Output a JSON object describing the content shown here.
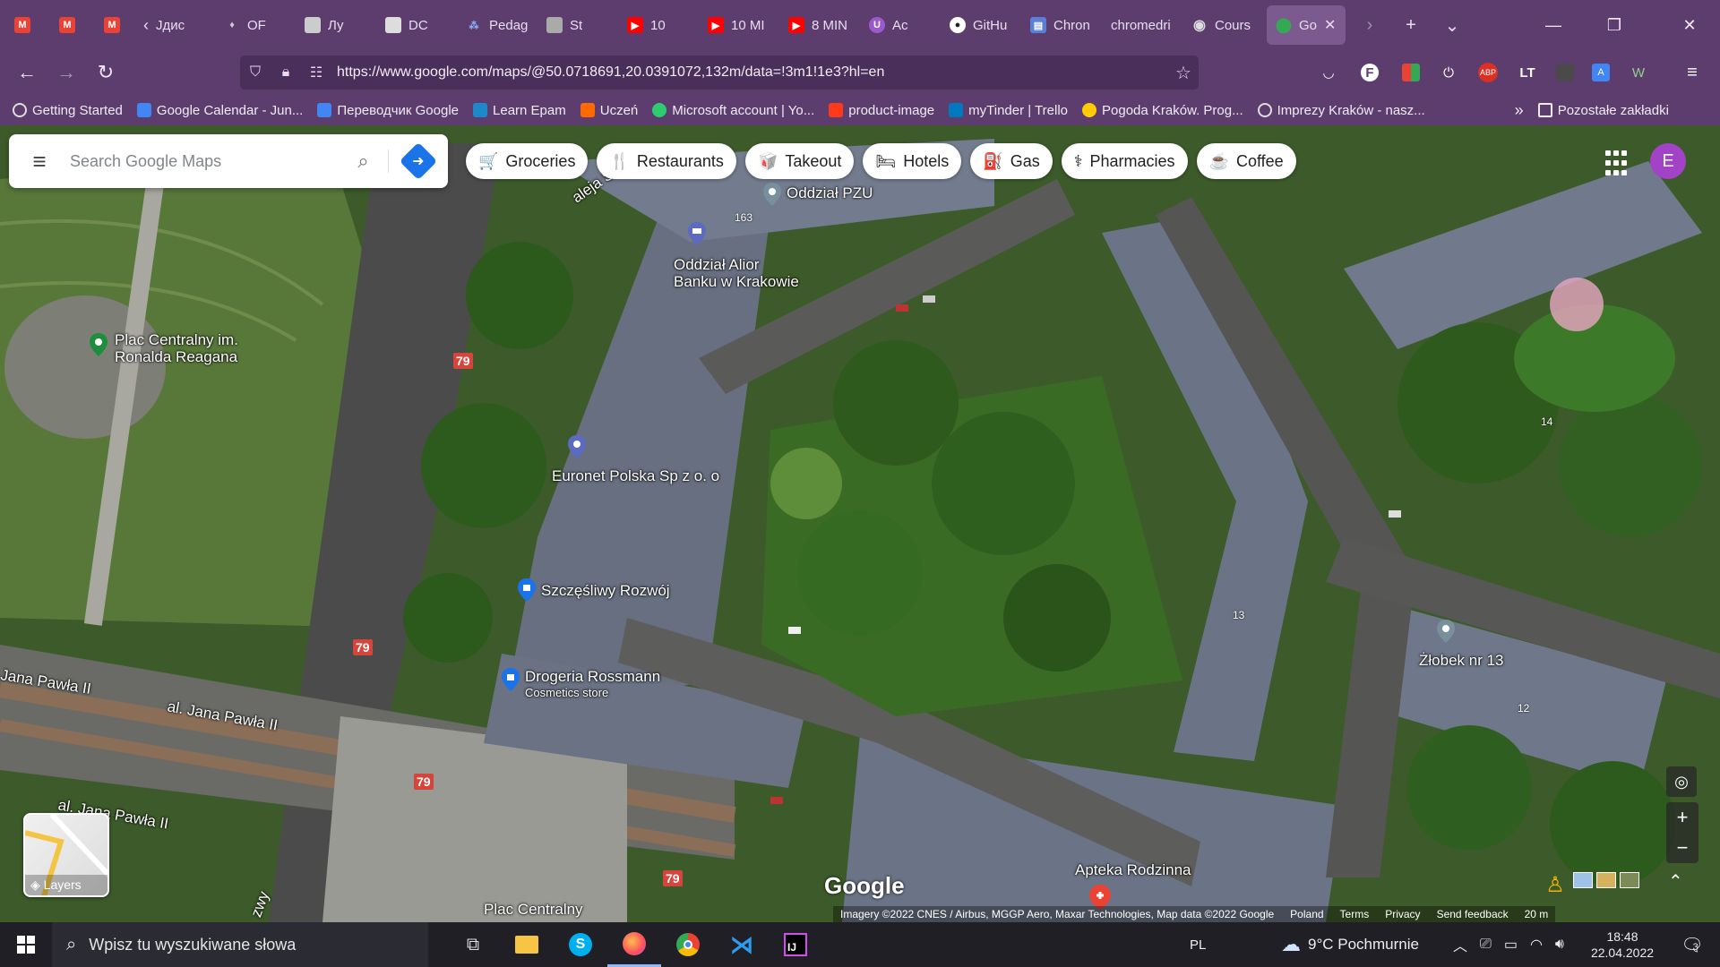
{
  "tabs": [
    {
      "label": "",
      "icon": "gmail-icon",
      "color": "#ea4335"
    },
    {
      "label": "",
      "icon": "gmail-icon",
      "color": "#ea4335"
    },
    {
      "label": "",
      "icon": "gmail-icon",
      "color": "#ea4335"
    },
    {
      "label": "Јдис",
      "icon": "tab-icon",
      "color": "#888888"
    },
    {
      "label": "OF",
      "icon": "droplet-icon",
      "color": "#cccccc"
    },
    {
      "label": "Лу",
      "icon": "doc-icon",
      "color": "#cccccc"
    },
    {
      "label": "DC",
      "icon": "doc-icon",
      "color": "#cccccc"
    },
    {
      "label": "Pedag",
      "icon": "team-icon",
      "color": "#5b7fd6"
    },
    {
      "label": "St",
      "icon": "doc-icon",
      "color": "#aaaaaa"
    },
    {
      "label": "10",
      "icon": "youtube-icon",
      "color": "#ff0000"
    },
    {
      "label": "10 MI",
      "icon": "youtube-icon",
      "color": "#ff0000"
    },
    {
      "label": "8 MIN",
      "icon": "youtube-icon",
      "color": "#ff0000"
    },
    {
      "label": "Ac",
      "icon": "shield-icon",
      "color": "#9b59d0"
    },
    {
      "label": "GitHu",
      "icon": "github-icon",
      "color": "#ffffff"
    },
    {
      "label": "Chron",
      "icon": "chrome-icon",
      "color": "#5b7fd6"
    },
    {
      "label": "chromedri",
      "icon": "",
      "color": ""
    },
    {
      "label": "Cours",
      "icon": "globe-icon",
      "color": "#cccccc"
    },
    {
      "label": "Go",
      "icon": "maps-pin-icon",
      "color": "#34a853"
    }
  ],
  "url": "https://www.google.com/maps/@50.0718691,20.0391072,132m/data=!3m1!1e3?hl=en",
  "url_host": "www.google.com",
  "bookmarks": [
    {
      "label": "Getting Started",
      "color": "#cccccc"
    },
    {
      "label": "Google Calendar - Jun...",
      "color": "#4285f4"
    },
    {
      "label": "Переводчик Google",
      "color": "#4285f4"
    },
    {
      "label": "Learn Epam",
      "color": "#1e88c9"
    },
    {
      "label": "Uczeń",
      "color": "#ff6a00"
    },
    {
      "label": "Microsoft account | Yo...",
      "color": "#2ecc71"
    },
    {
      "label": "product-image",
      "color": "#ff3a1a"
    },
    {
      "label": "myTinder | Trello",
      "color": "#0079bf"
    },
    {
      "label": "Pogoda Kraków. Prog...",
      "color": "#ffcc00"
    },
    {
      "label": "Imprezy Kraków - nasz...",
      "color": "#cccccc"
    }
  ],
  "bookmarks_other": "Pozostałe zakładki",
  "search": {
    "placeholder": "Search Google Maps"
  },
  "chips": [
    {
      "label": "Groceries",
      "icon": "cart-icon",
      "glyph": "🛒"
    },
    {
      "label": "Restaurants",
      "icon": "fork-knife-icon",
      "glyph": "🍴"
    },
    {
      "label": "Takeout",
      "icon": "takeout-icon",
      "glyph": "🥡"
    },
    {
      "label": "Hotels",
      "icon": "bed-icon",
      "glyph": "🛏"
    },
    {
      "label": "Gas",
      "icon": "gas-pump-icon",
      "glyph": "⛽"
    },
    {
      "label": "Pharmacies",
      "icon": "pharmacy-icon",
      "glyph": "⚕"
    },
    {
      "label": "Coffee",
      "icon": "coffee-icon",
      "glyph": "☕"
    }
  ],
  "avatar_letter": "E",
  "map_labels": {
    "plac_centralny_reagan": "Plac Centralny im.\nRonalda Reagana",
    "oddzial_pzu": "Oddział PZU",
    "alior": "Oddział Alior\nBanku w Krakowie",
    "euronet": "Euronet Polska Sp z o. o",
    "szczesliwy": "Szczęśliwy Rozwój",
    "rossmann": "Drogeria Rossmann",
    "rossmann_sub": "Cosmetics store",
    "zlobek": "Żłobek nr 13",
    "apteka": "Apteka Rodzinna",
    "plac_centralny_bottom": "Plac Centralny",
    "street_jana_pawla_1": "Jana Pawła II",
    "street_jana_pawla_2": "al. Jana Pawła II",
    "street_jana_pawla_3": "al. Jana Pawła II",
    "street_aleja": "aleja S",
    "street_bottom": "zwy"
  },
  "route_badges": [
    "79",
    "79",
    "79",
    "79"
  ],
  "building_numbers": [
    "163",
    "14",
    "13",
    "12"
  ],
  "layers_label": "Layers",
  "google_logo": "Google",
  "attribution": [
    "Imagery ©2022 CNES / Airbus, MGGP Aero, Maxar Technologies, Map data ©2022 Google",
    "Poland",
    "Terms",
    "Privacy",
    "Send feedback",
    "20 m"
  ],
  "taskbar": {
    "search_placeholder": "Wpisz tu wyszukiwane słowa",
    "language": "PL",
    "weather": "9°C  Pochmurnie",
    "time": "18:48",
    "date": "22.04.2022",
    "notifications": "3"
  },
  "colors": {
    "chrome_bg": "#5c3d6e",
    "url_bg": "#4a2f5a",
    "taskbar_bg": "#1f1f25",
    "maps_blue": "#1a73e8",
    "route_red": "#d6453b",
    "avatar": "#a142c7"
  }
}
